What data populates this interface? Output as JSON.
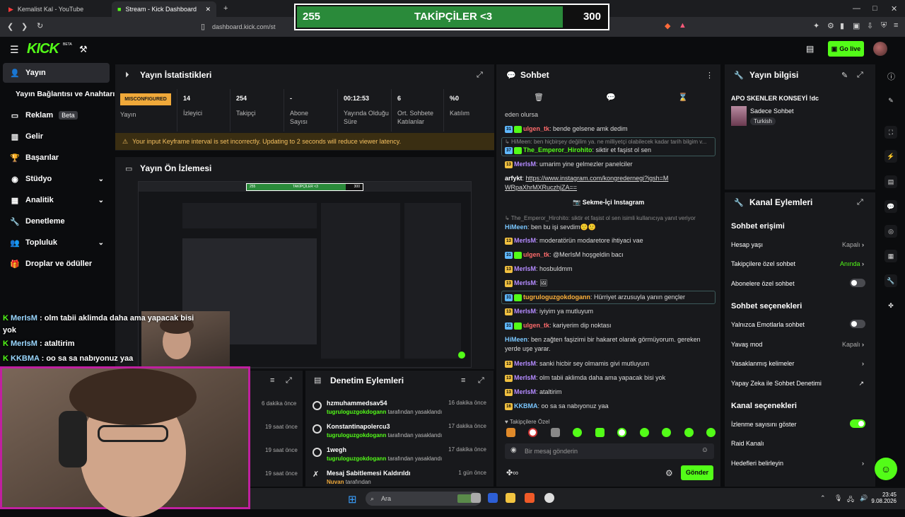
{
  "browser": {
    "tabs": [
      {
        "label": "Kemalist Kal - YouTube"
      },
      {
        "label": "Stream - Kick Dashboard"
      }
    ],
    "url": "dashboard.kick.com/st"
  },
  "overlay": {
    "left": "255",
    "center": "TAKİPÇİLER <3",
    "right": "300",
    "progress": 0.85
  },
  "header": {
    "logo": "KICK",
    "beta": "BETA",
    "golive_label": "Go live"
  },
  "sidebar": {
    "items": [
      {
        "label": "Yayın"
      },
      {
        "label": "Yayın Bağlantısı ve Anahtarı"
      },
      {
        "label": "Reklam",
        "badge": "Beta"
      },
      {
        "label": "Gelir"
      },
      {
        "label": "Başarılar"
      },
      {
        "label": "Stüdyo"
      },
      {
        "label": "Analitik"
      },
      {
        "label": "Denetleme"
      },
      {
        "label": "Topluluk"
      },
      {
        "label": "Droplar ve ödüller"
      }
    ]
  },
  "stats": {
    "title": "Yayın İstatistikleri",
    "status": "MISCONFIGURED",
    "status_label": "Yayın",
    "cells": [
      {
        "value": "14",
        "label": "İzleyici"
      },
      {
        "value": "254",
        "label": "Takipçi"
      },
      {
        "value": "-",
        "label": "Abone Sayısı"
      },
      {
        "value": "00:12:53",
        "label": "Yayında Olduğu Süre"
      },
      {
        "value": "6",
        "label": "Ort. Sohbete Katılanlar"
      },
      {
        "value": "%0",
        "label": "Katılım"
      }
    ],
    "warning": "Your input Keyframe interval is set incorrectly. Updating to 2 seconds will reduce viewer latency."
  },
  "preview": {
    "title": "Yayın Ön İzlemesi",
    "mini_left": "255",
    "mini_center": "TAKİPÇİLER <3",
    "mini_right": "300"
  },
  "stream_chat_overlay": [
    {
      "user": "MerIsM",
      "text": "olm tabii aklimda daha ama yapacak bisi yok"
    },
    {
      "user": "MerIsM",
      "text": "ataltirim"
    },
    {
      "user": "KKBMA",
      "text": "oo sa sa nabıyonuz yaa"
    }
  ],
  "left_times": [
    "6 dakika önce",
    "19 saat önce",
    "19 saat önce",
    "19 saat önce"
  ],
  "moderation": {
    "title": "Denetim Eylemleri",
    "rows": [
      {
        "title": "hzmuhammedsav54",
        "by": "tugruloguzgokdogann",
        "suffix": "tarafından yasaklandı",
        "time": "16 dakika önce"
      },
      {
        "title": "Konstantinapolercu3",
        "by": "tugruloguzgokdogann",
        "suffix": "tarafından yasaklandı",
        "time": "17 dakika önce"
      },
      {
        "title": "1wegh",
        "by": "tugruloguzgokdogann",
        "suffix": "tarafından yasaklandı",
        "time": "17 dakika önce"
      },
      {
        "title": "Mesaj Sabitlemesi Kaldırıldı",
        "by": "Nuvan",
        "suffix": "tarafından",
        "time": "1 gün önce"
      }
    ]
  },
  "chat": {
    "title": "Sohbet",
    "top_partial": "eden olursa",
    "messages": [
      {
        "badge": "31",
        "user": "ulgen_tk",
        "text": "bende gelsene amk dedim",
        "color": "#ff6b6b"
      },
      {
        "reply": "HiMeen: ben hiçbirşey değilim ya. ne milliyetçi olabilecek kadar tarih bilgim v..."
      },
      {
        "badge": "37",
        "user": "The_Emperor_Hirohito",
        "text": "siktir et faşist ol sen",
        "color": "#53fc18"
      },
      {
        "badge": "13",
        "user": "MerIsM",
        "text": "umarim yine gelmezler panelciler",
        "color": "#b48bff"
      },
      {
        "user": "arfykt",
        "text": "https://www.instagram.com/kongredernegi?igsh=MWRpaXhrMXRuczhjZA==",
        "color": "#ffffff"
      },
      {
        "button": "Sekme-İçi Instagram"
      },
      {
        "reply": "The_Emperor_Hirohito: siktir et faşist ol sen isimli kullanıcıya yanıt veriyor"
      },
      {
        "user": "HiMeen",
        "text": "ben bu işi sevdim🙂🙂",
        "color": "#7ac7ff"
      },
      {
        "badge": "13",
        "user": "MerIsM",
        "text": "moderatörün modaretore ihtiyaci vae",
        "color": "#b48bff"
      },
      {
        "badge": "31",
        "user": "ulgen_tk",
        "text": "@MerIsM hoşgeldin bacı",
        "color": "#ff6b6b"
      },
      {
        "badge": "13",
        "user": "MerIsM",
        "text": "hosbuldmm",
        "color": "#b48bff"
      },
      {
        "badge": "13",
        "user": "MerIsM",
        "text": "🖼",
        "color": "#b48bff"
      },
      {
        "badge": "31",
        "user": "tugruloguzgokdogann",
        "text": "Hürriyet arzusuyla yanın gençler",
        "color": "#ffb23a"
      },
      {
        "badge": "13",
        "user": "MerIsM",
        "text": "iyiyim ya mutluyum",
        "color": "#b48bff"
      },
      {
        "badge": "31",
        "user": "ulgen_tk",
        "text": "kariyerim dip noktası",
        "color": "#ff6b6b"
      },
      {
        "user": "HiMeen",
        "text": "ben zağten faşizimi bir hakaret olarak görmüyorum. gereken yerde uşe yarar.",
        "color": "#7ac7ff"
      },
      {
        "badge": "13",
        "user": "MerIsM",
        "text": "sanki hicbir sey olmamis givi mutluyum",
        "color": "#b48bff"
      },
      {
        "badge": "13",
        "user": "MerIsM",
        "text": "olm tabii aklimda daha ama yapacak bisi yok",
        "color": "#b48bff"
      },
      {
        "badge": "13",
        "user": "MerIsM",
        "text": "ataltirim",
        "color": "#b48bff"
      },
      {
        "badge": "16",
        "user": "KKBMA",
        "text": "oo sa sa nabıyonuz yaa",
        "color": "#7ac7ff"
      }
    ],
    "followers_only": "Takipçilere Özel",
    "input_placeholder": "Bir mesaj gönderin",
    "send_label": "Gönder"
  },
  "stream_info": {
    "title": "Yayın bilgisi",
    "stream_title": "APO SKENLER KONSEYİ !dc",
    "category": "Sadece Sohbet",
    "tag": "Turkish"
  },
  "channel_actions": {
    "title": "Kanal Eylemleri",
    "sections": {
      "chat_access": "Sohbet erişimi",
      "chat_options": "Sohbet seçenekleri",
      "channel_options": "Kanal seçenekleri"
    },
    "rows": [
      {
        "label": "Hesap yaşı",
        "value": "Kapalı"
      },
      {
        "label": "Takipçilere özel sohbet",
        "value": "Anında"
      },
      {
        "label": "Abonelere özel sohbet",
        "toggle": false
      },
      {
        "label": "Yalnızca Emotlarla sohbet",
        "toggle": false
      },
      {
        "label": "Yavaş mod",
        "value": "Kapalı"
      },
      {
        "label": "Yasaklanmış kelimeler"
      },
      {
        "label": "Yapay Zeka ile Sohbet Denetimi"
      },
      {
        "label": "İzlenme sayısını göster",
        "toggle": true
      },
      {
        "label": "Raid Kanalı"
      },
      {
        "label": "Hedefleri belirleyin"
      }
    ]
  },
  "taskbar": {
    "search": "Ara",
    "time": "23:45",
    "date": "9.08.2026"
  }
}
